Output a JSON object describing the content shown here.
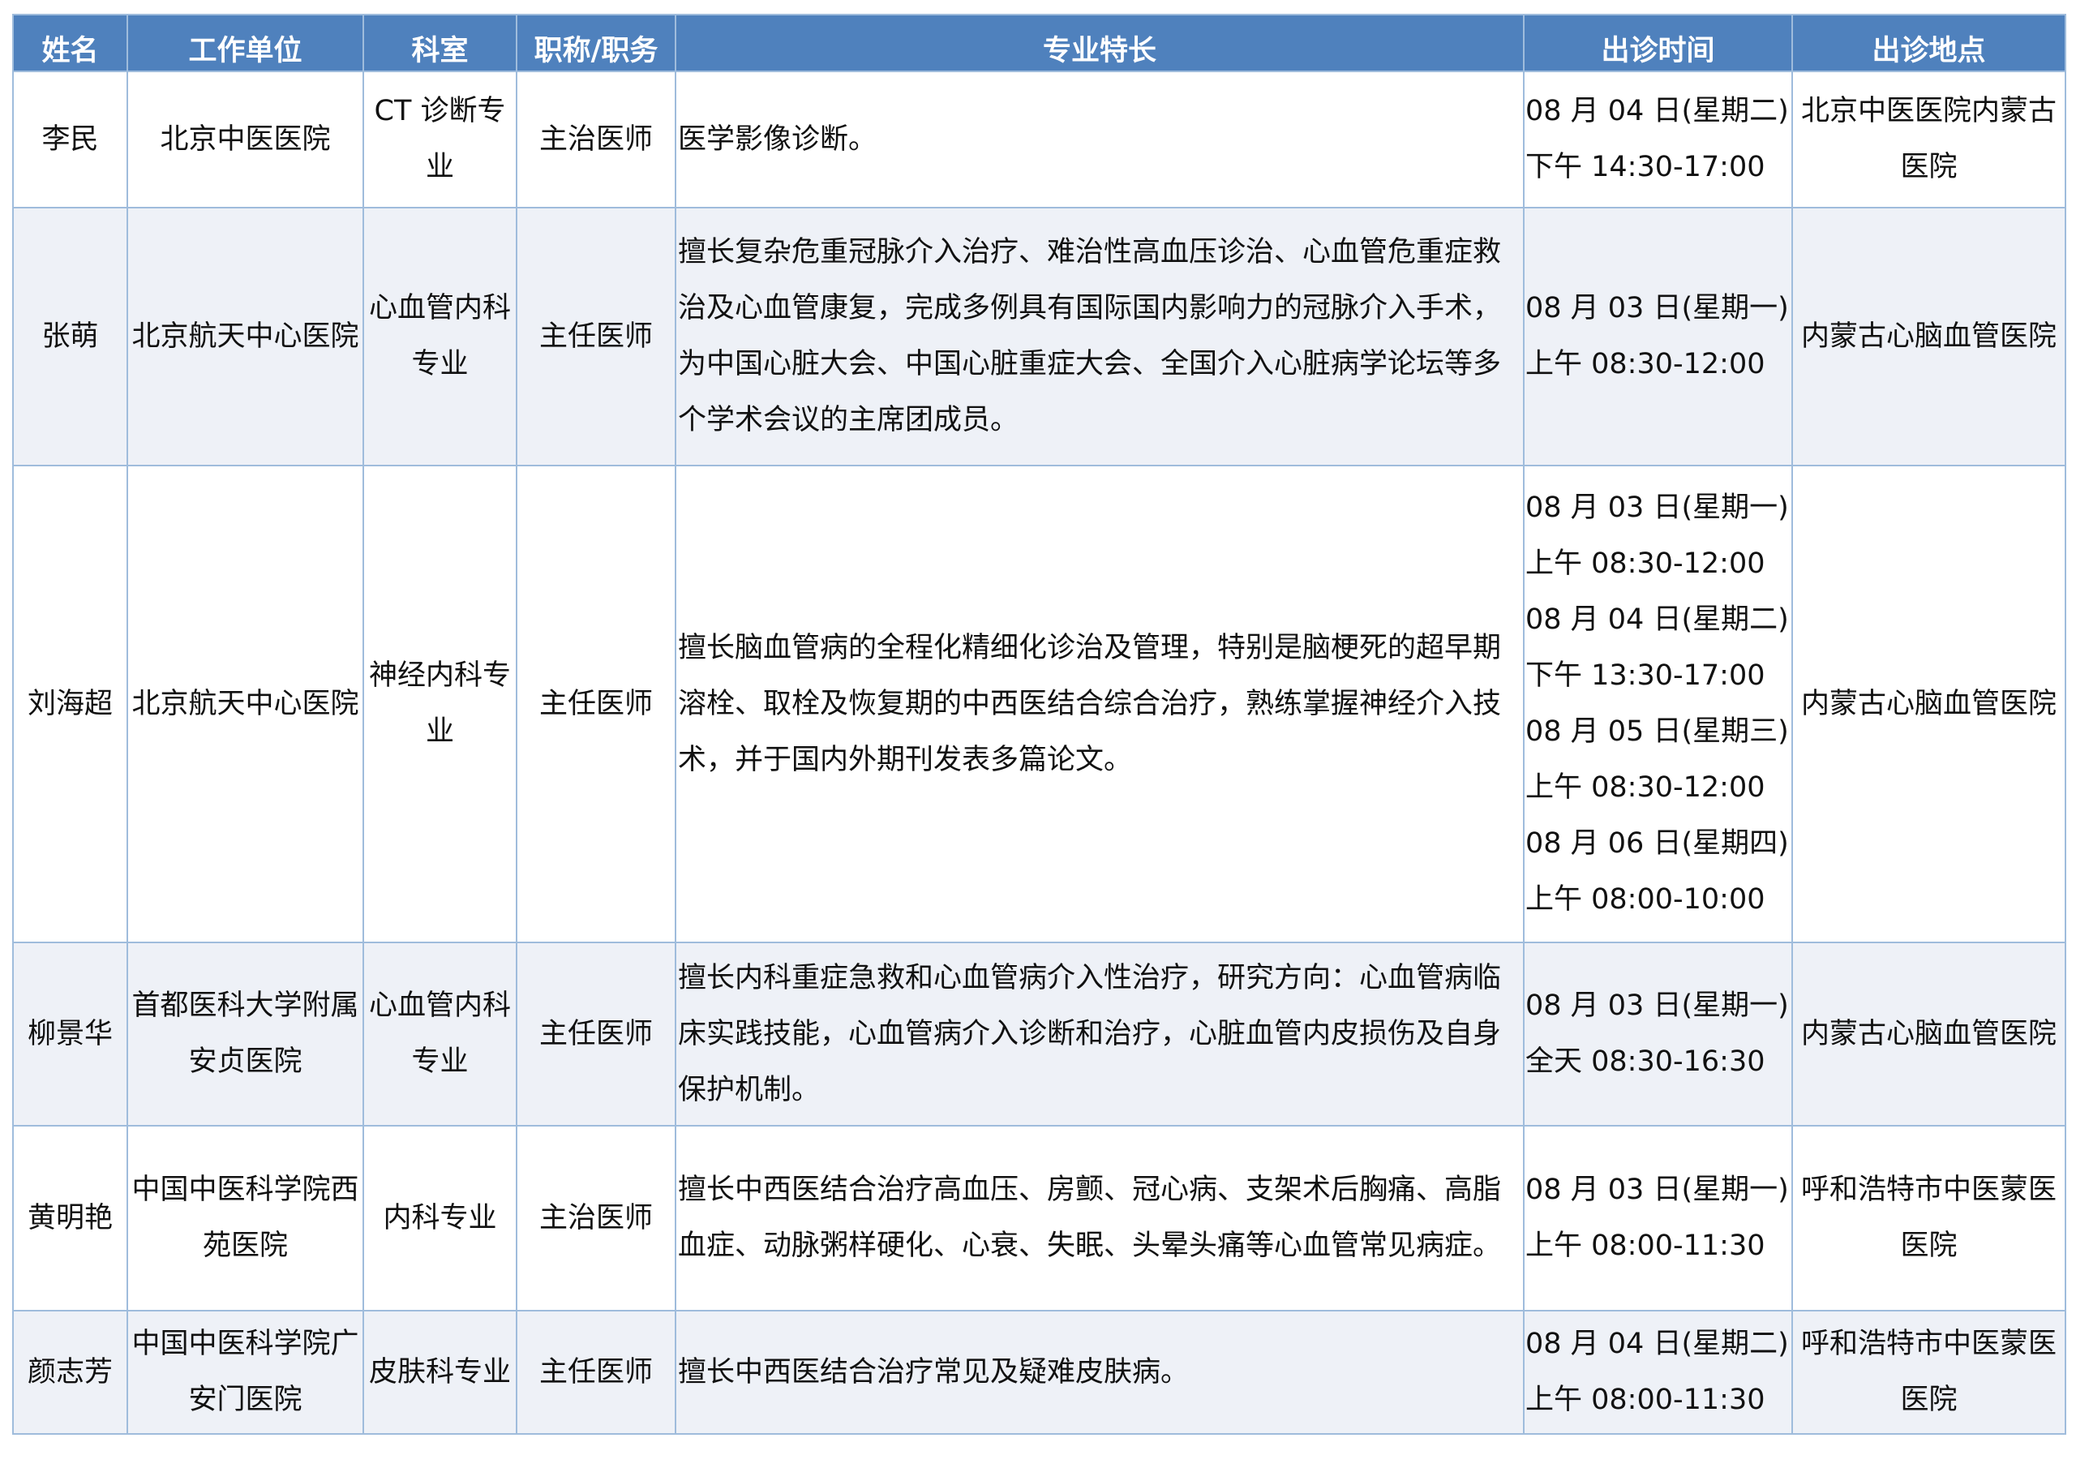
{
  "headers": [
    "姓名",
    "工作单位",
    "科室",
    "职称/职务",
    "专业特长",
    "出诊时间",
    "出诊地点"
  ],
  "rows": [
    {
      "name": "李民",
      "unit": "北京中医医院",
      "dept": "CT 诊断专业",
      "title": "主治医师",
      "specialty": "医学影像诊断。",
      "times": [
        "08 月 04 日(星期二)",
        "下午 14:30-17:00"
      ],
      "location": "北京中医医院内蒙古医院"
    },
    {
      "name": "张萌",
      "unit": "北京航天中心医院",
      "dept": "心血管内科专业",
      "title": "主任医师",
      "specialty": "擅长复杂危重冠脉介入治疗、难治性高血压诊治、心血管危重症救治及心血管康复，完成多例具有国际国内影响力的冠脉介入手术，为中国心脏大会、中国心脏重症大会、全国介入心脏病学论坛等多个学术会议的主席团成员。",
      "times": [
        "08 月 03 日(星期一)",
        "上午 08:30-12:00"
      ],
      "location": "内蒙古心脑血管医院"
    },
    {
      "name": "刘海超",
      "unit": "北京航天中心医院",
      "dept": "神经内科专业",
      "title": "主任医师",
      "specialty": "擅长脑血管病的全程化精细化诊治及管理，特别是脑梗死的超早期溶栓、取栓及恢复期的中西医结合综合治疗，熟练掌握神经介入技术，并于国内外期刊发表多篇论文。",
      "times": [
        "08 月 03 日(星期一)",
        "上午 08:30-12:00",
        "08 月 04 日(星期二)",
        "下午 13:30-17:00",
        "08 月 05 日(星期三)",
        "上午 08:30-12:00",
        "08 月 06 日(星期四)",
        "上午 08:00-10:00"
      ],
      "location": "内蒙古心脑血管医院"
    },
    {
      "name": "柳景华",
      "unit": "首都医科大学附属安贞医院",
      "dept": "心血管内科专业",
      "title": "主任医师",
      "specialty": "擅长内科重症急救和心血管病介入性治疗，研究方向：心血管病临床实践技能，心血管病介入诊断和治疗，心脏血管内皮损伤及自身保护机制。",
      "times": [
        "08 月 03 日(星期一)",
        "全天 08:30-16:30"
      ],
      "location": "内蒙古心脑血管医院"
    },
    {
      "name": "黄明艳",
      "unit": "中国中医科学院西苑医院",
      "dept": "内科专业",
      "title": "主治医师",
      "specialty": "擅长中西医结合治疗高血压、房颤、冠心病、支架术后胸痛、高脂血症、动脉粥样硬化、心衰、失眠、头晕头痛等心血管常见病症。",
      "times": [
        "08 月 03 日(星期一)",
        "上午 08:00-11:30"
      ],
      "location": "呼和浩特市中医蒙医医院"
    },
    {
      "name": "颜志芳",
      "unit": "中国中医科学院广安门医院",
      "dept": "皮肤科专业",
      "title": "主任医师",
      "specialty": "擅长中西医结合治疗常见及疑难皮肤病。",
      "times": [
        "08 月 04 日(星期二)",
        "上午 08:00-11:30"
      ],
      "location": "呼和浩特市中医蒙医医院"
    }
  ]
}
